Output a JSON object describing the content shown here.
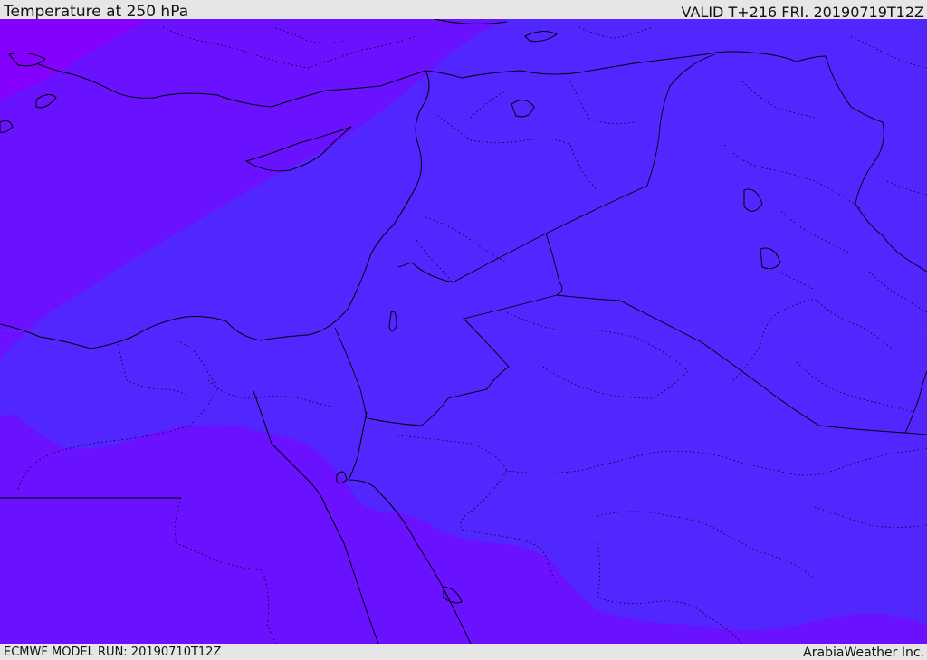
{
  "header": {
    "title": "Temperature at 250 hPa",
    "valid": "VALID T+216 FRI. 20190719T12Z"
  },
  "footer": {
    "model_run": "ECMWF MODEL RUN: 20190710T12Z",
    "credit": "ArabiaWeather Inc."
  },
  "colors": {
    "warm_band": "#5226ff",
    "mid_band": "#6a12ff",
    "cold_band": "#8400ff",
    "border": "#000000",
    "chrome": "#e6e6e6"
  }
}
